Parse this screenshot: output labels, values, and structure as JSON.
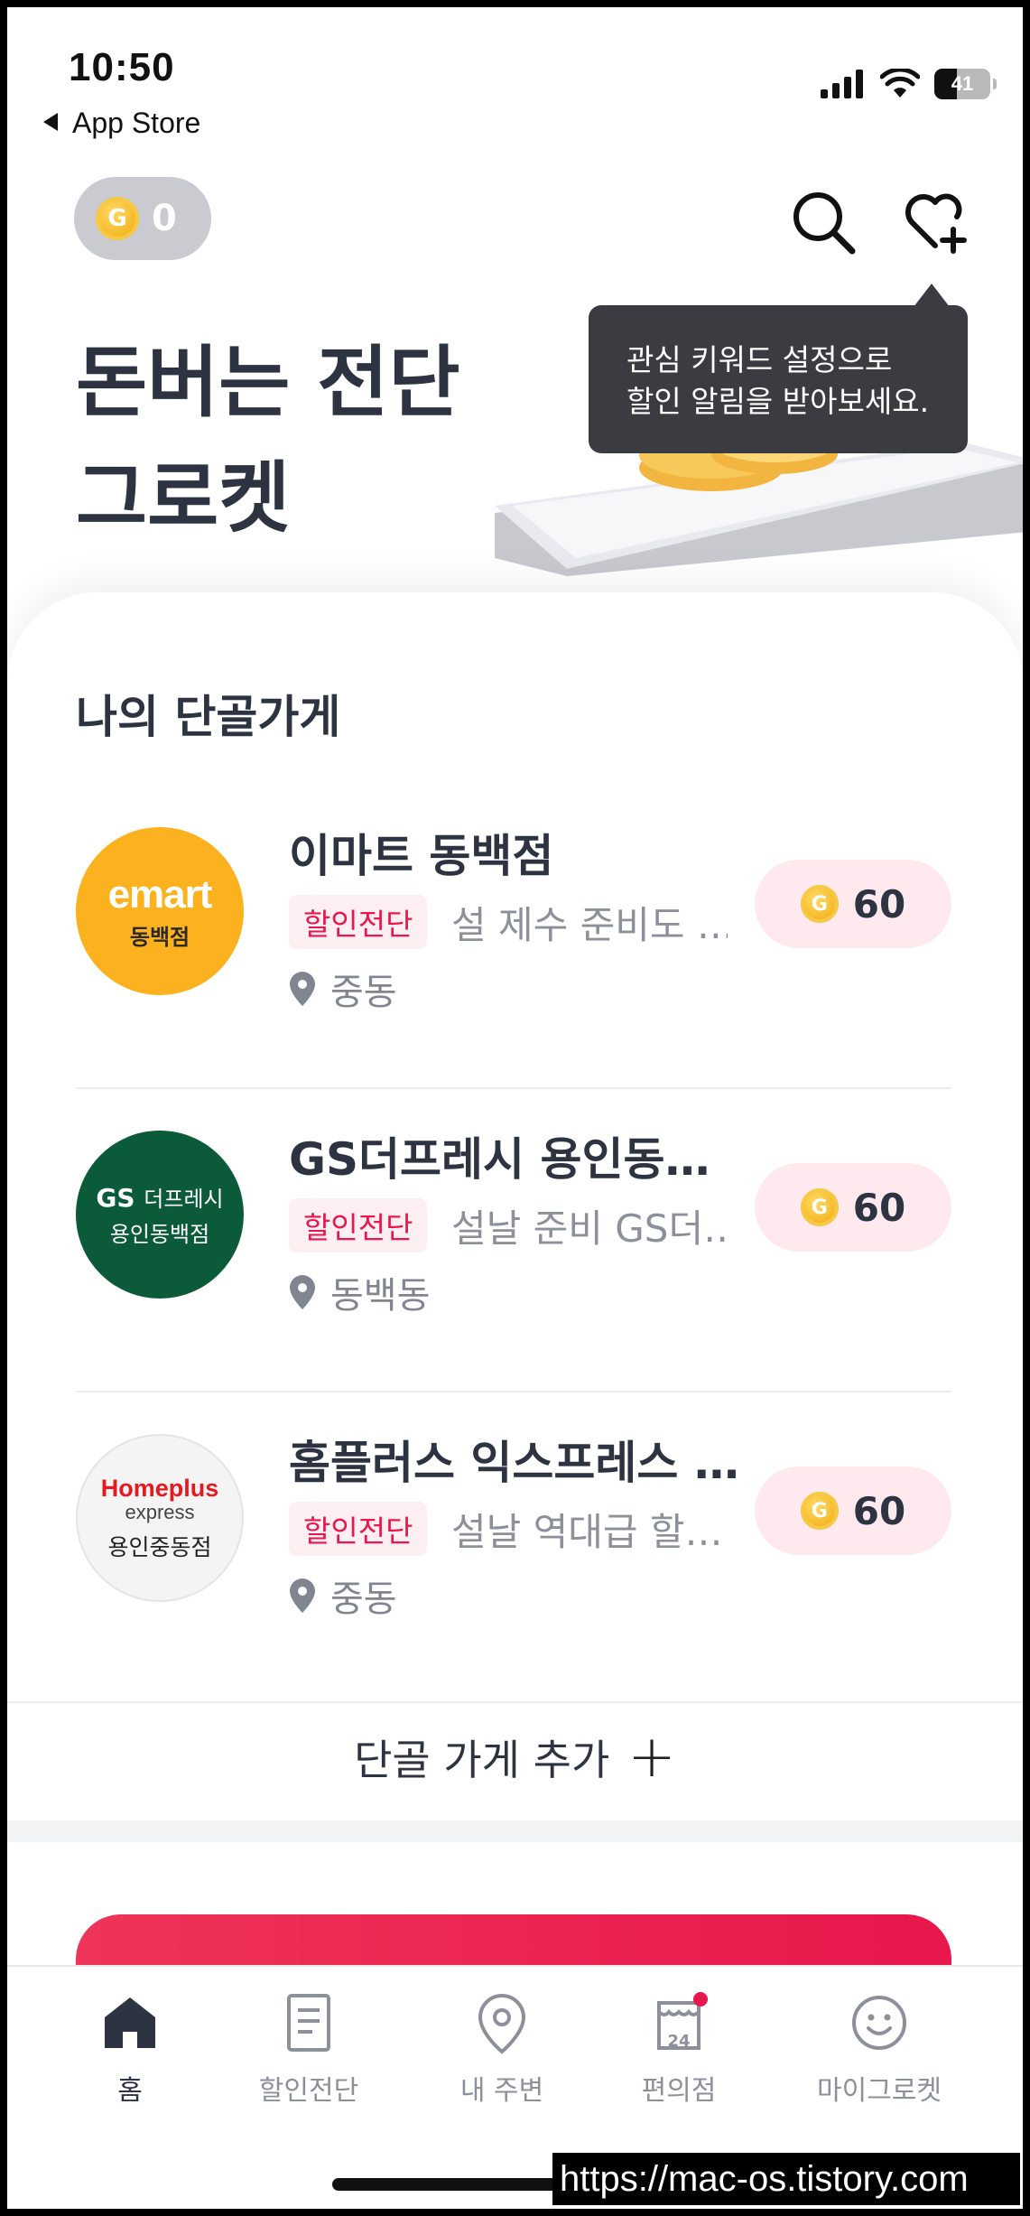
{
  "status_bar": {
    "time": "10:50",
    "back_label": "App Store",
    "battery": "41"
  },
  "header": {
    "coin_symbol": "G",
    "coin_balance": "0"
  },
  "hero": {
    "line1": "돈버는 전단",
    "line2": "그로켓"
  },
  "tooltip": {
    "line1": "관심 키워드 설정으로",
    "line2": "할인 알림을 받아보세요."
  },
  "section": {
    "title": "나의 단골가게"
  },
  "stores": [
    {
      "name": "이마트 동백점",
      "tag": "할인전단",
      "promo": "설 제수 준비도 …",
      "location": "중동",
      "reward": "60",
      "logo": {
        "brand": "emart",
        "sub": "동백점"
      }
    },
    {
      "name": "GS더프레시 용인동백점",
      "tag": "할인전단",
      "promo": "설날 준비 GS더…",
      "location": "동백동",
      "reward": "60",
      "logo": {
        "brand": "GS",
        "brand2": "더프레시",
        "sub": "용인동백점"
      }
    },
    {
      "name": "홈플러스 익스프레스 …",
      "tag": "할인전단",
      "promo": "설날 역대급 할…",
      "location": "중동",
      "reward": "60",
      "logo": {
        "brand": "Homeplus",
        "brand2": "express",
        "sub": "용인중동점"
      }
    }
  ],
  "add_store": {
    "label": "단골 가게 추가",
    "plus": "+"
  },
  "tabs": [
    {
      "label": "홈",
      "icon": "home-icon",
      "active": true
    },
    {
      "label": "할인전단",
      "icon": "flyer-icon"
    },
    {
      "label": "내 주변",
      "icon": "location-pin-icon"
    },
    {
      "label": "편의점",
      "icon": "convenience-store-icon",
      "badge_text": "24"
    },
    {
      "label": "마이그로켓",
      "icon": "smiley-icon"
    }
  ],
  "watermark": "https://mac-os.tistory.com",
  "colors": {
    "accent": "#e8174c",
    "text_dark": "#2d3340",
    "coin": "#f3b51e",
    "emart": "#fbb21e",
    "gs": "#0b5a3a"
  }
}
